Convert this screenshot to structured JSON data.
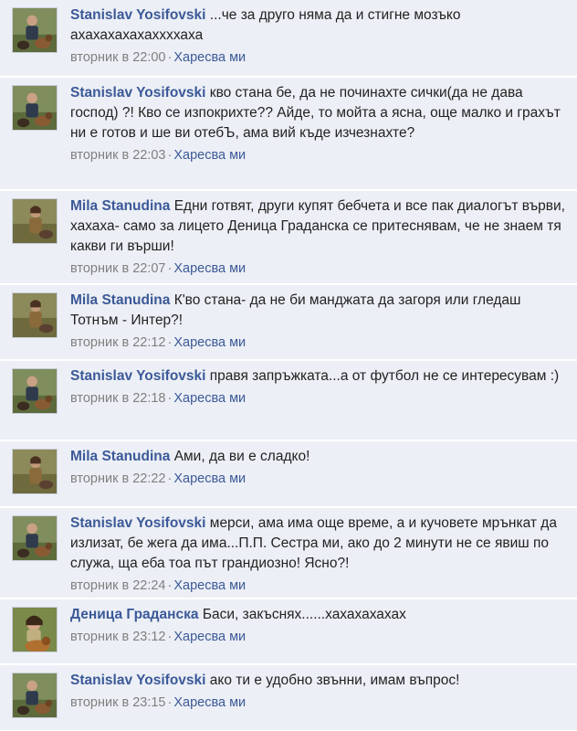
{
  "colors": {
    "background": "#eceff5",
    "author": "#3b5998",
    "meta": "#808080",
    "text": "#222222"
  },
  "comments": [
    {
      "author": "Stanislav Yosifovski",
      "avatar": "stanislav-avatar",
      "text": "...че за друго няма да и стигне мозъко ахахахахахаххххаха",
      "time": "вторник в 22:00",
      "like": "Харесва ми"
    },
    {
      "author": "Stanislav Yosifovski",
      "avatar": "stanislav-avatar",
      "text": "кво стана бе, да не починахте сички(да не дава господ) ?! Кво се изпокрихте?? Айде, то мойта а ясна, още малко и грахът ни е готов и ше ви отебЪ, ама вий къде изчезнахте?",
      "time": "вторник в 22:03",
      "like": "Харесва ми"
    },
    {
      "author": "Mila Stanudina",
      "avatar": "mila-avatar",
      "text": "Едни готвят, други купят бебчета и все пак диалогът върви, хахаха- само за лицето Деница Граданска се притеснявам, че не знаем тя какви ги върши!",
      "time": "вторник в 22:07",
      "like": "Харесва ми"
    },
    {
      "author": "Mila Stanudina",
      "avatar": "mila-avatar",
      "text": "К'во стана- да не би манджата да загоря или гледаш Тотнъм - Интер?!",
      "time": "вторник в 22:12",
      "like": "Харесва ми"
    },
    {
      "author": "Stanislav Yosifovski",
      "avatar": "stanislav-avatar",
      "text": "правя запръжката...а от футбол не се интересувам :)",
      "time": "вторник в 22:18",
      "like": "Харесва ми"
    },
    {
      "author": "Mila Stanudina",
      "avatar": "mila-avatar",
      "text": "Ами, да ви е сладко!",
      "time": "вторник в 22:22",
      "like": "Харесва ми"
    },
    {
      "author": "Stanislav Yosifovski",
      "avatar": "stanislav-avatar",
      "text": "мерси, ама има още време, а и кучовете мрънкат да излизат, бе жега да има...П.П. Сестра ми, ако до 2 минути не се явиш по служа, ща еба тоа път грандиозно! Ясно?!",
      "time": "вторник в 22:24",
      "like": "Харесва ми"
    },
    {
      "author": "Деница Граданска",
      "avatar": "denitsa-avatar",
      "text": "Баси, закъснях......хахахахахах",
      "time": "вторник в 23:12",
      "like": "Харесва ми"
    },
    {
      "author": "Stanislav Yosifovski",
      "avatar": "stanislav-avatar",
      "text": "ако ти е удобно звънни, имам въпрос!",
      "time": "вторник в 23:15",
      "like": "Харесва ми"
    }
  ]
}
